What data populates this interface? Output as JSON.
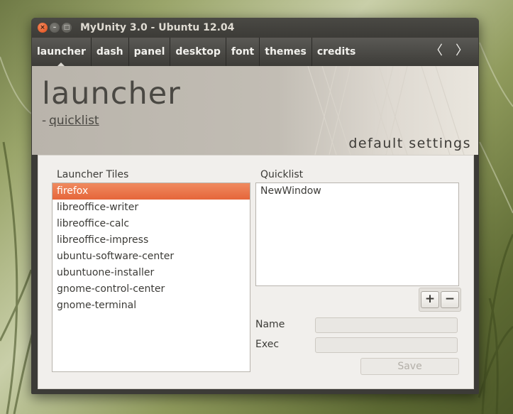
{
  "window": {
    "title": "MyUnity 3.0 - Ubuntu 12.04",
    "close_glyph": "×",
    "min_glyph": "–",
    "max_glyph": "□"
  },
  "nav": {
    "items": [
      {
        "label": "launcher",
        "active": true
      },
      {
        "label": "dash",
        "active": false
      },
      {
        "label": "panel",
        "active": false
      },
      {
        "label": "desktop",
        "active": false
      },
      {
        "label": "font",
        "active": false
      },
      {
        "label": "themes",
        "active": false
      },
      {
        "label": "credits",
        "active": false
      }
    ],
    "prev_glyph": "〈",
    "next_glyph": "〉"
  },
  "header": {
    "title": "launcher",
    "sub_prefix": "-",
    "sub_link": "quicklist",
    "default_settings": "default settings"
  },
  "tiles": {
    "label": "Launcher Tiles",
    "items": [
      "firefox",
      "libreoffice-writer",
      "libreoffice-calc",
      "libreoffice-impress",
      "ubuntu-software-center",
      "ubuntuone-installer",
      "gnome-control-center",
      "gnome-terminal"
    ],
    "selected_index": 0
  },
  "quicklist": {
    "label": "Quicklist",
    "items": [
      "NewWindow"
    ],
    "add_label": "+",
    "remove_label": "−"
  },
  "form": {
    "name_label": "Name",
    "name_value": "",
    "exec_label": "Exec",
    "exec_value": "",
    "save_label": "Save"
  },
  "colors": {
    "accent": "#e5663a",
    "titlebar": "#3c3b37"
  }
}
